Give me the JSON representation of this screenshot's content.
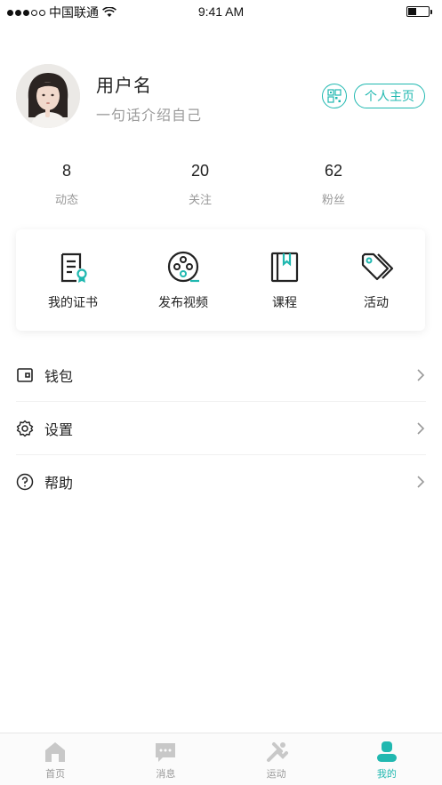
{
  "status_bar": {
    "carrier": "中国联通",
    "time": "9:41 AM"
  },
  "profile": {
    "username": "用户名",
    "bio": "一句话介绍自己",
    "home_button": "个人主页"
  },
  "stats": [
    {
      "value": "8",
      "label": "动态"
    },
    {
      "value": "20",
      "label": "关注"
    },
    {
      "value": "62",
      "label": "粉丝"
    }
  ],
  "quick_actions": [
    {
      "label": "我的证书",
      "icon": "certificate-icon"
    },
    {
      "label": "发布视频",
      "icon": "film-reel-icon"
    },
    {
      "label": "课程",
      "icon": "book-icon"
    },
    {
      "label": "活动",
      "icon": "tags-icon"
    }
  ],
  "menu": [
    {
      "label": "钱包",
      "icon": "wallet-icon"
    },
    {
      "label": "设置",
      "icon": "gear-icon"
    },
    {
      "label": "帮助",
      "icon": "help-icon"
    }
  ],
  "tab_bar": {
    "items": [
      {
        "label": "首页",
        "icon": "home-icon"
      },
      {
        "label": "消息",
        "icon": "message-icon"
      },
      {
        "label": "运动",
        "icon": "sport-icon"
      },
      {
        "label": "我的",
        "icon": "profile-icon"
      }
    ],
    "active_label": "我的"
  },
  "colors": {
    "accent": "#20b8b0",
    "text_primary": "#222222",
    "text_secondary": "#999999",
    "tab_inactive": "#c8c8c8"
  }
}
